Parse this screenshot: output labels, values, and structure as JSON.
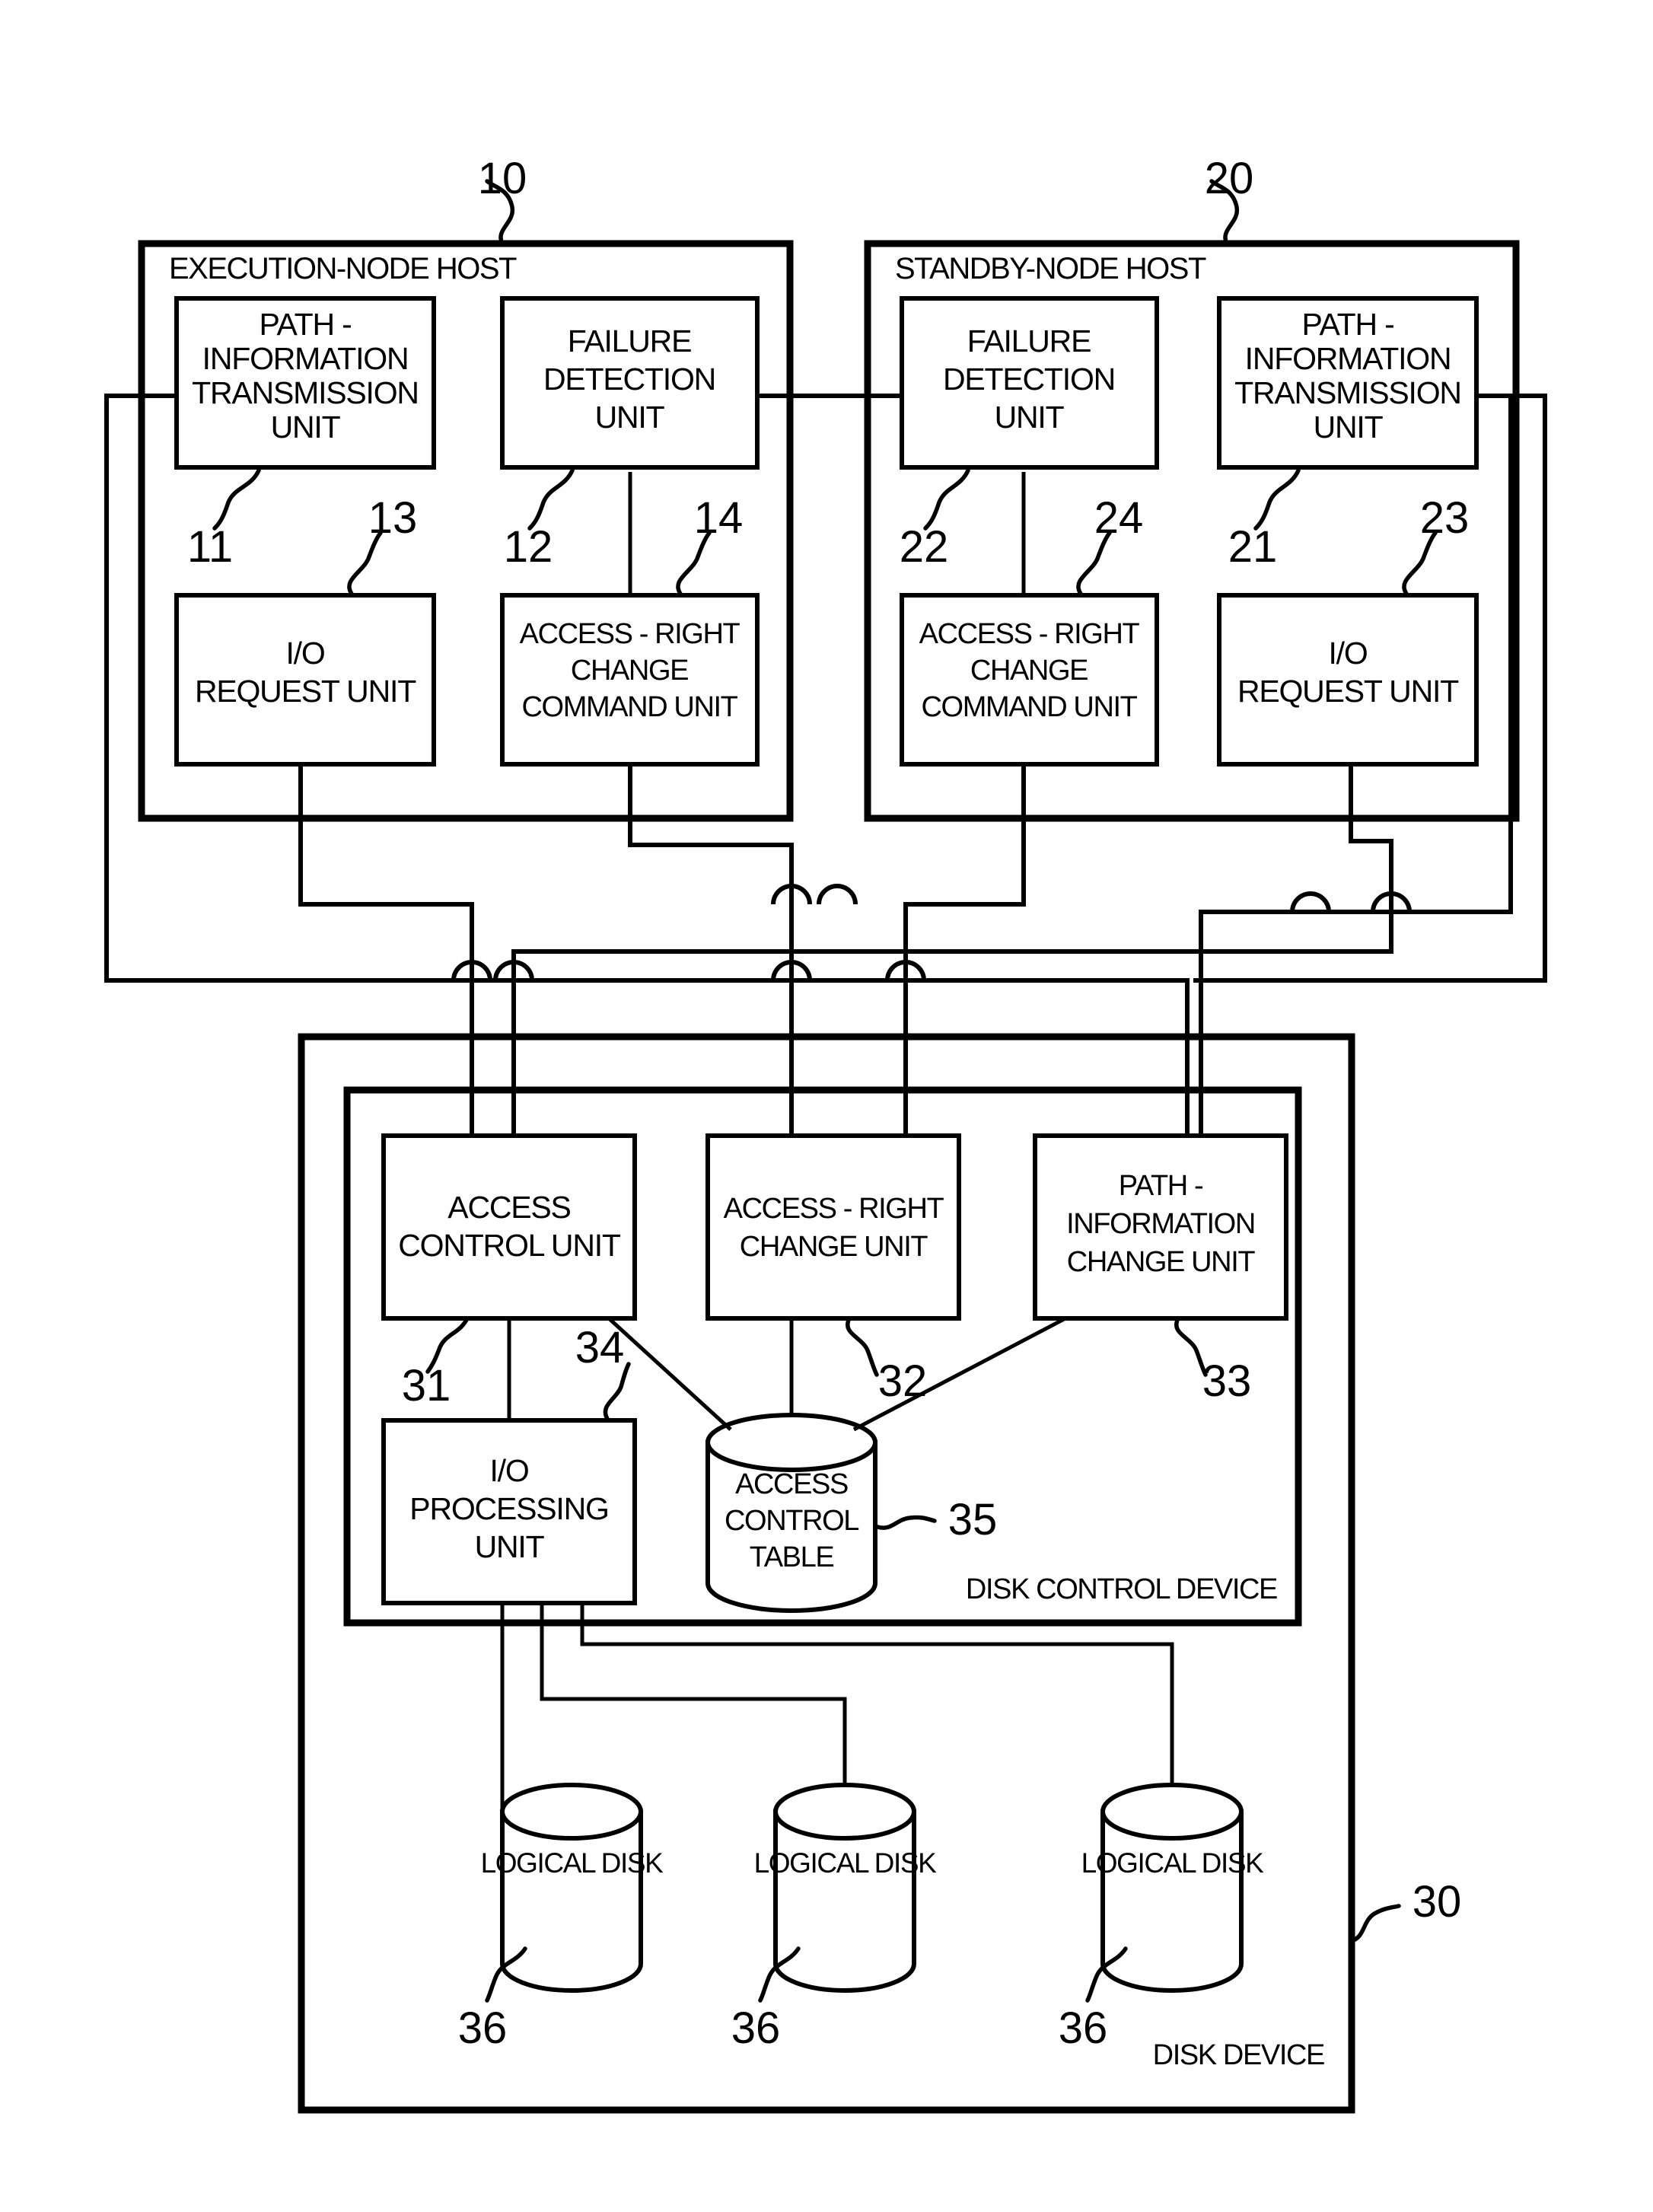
{
  "figure": {
    "title": "Patent figure: execution-node host / standby-node host / disk device block diagram",
    "line_color": "#000000",
    "background_color": "#ffffff"
  },
  "hosts": {
    "execution": {
      "label": "EXECUTION-NODE HOST",
      "ref": "10",
      "units": [
        {
          "id": "path-info-tx-10",
          "ref": "11",
          "lines": [
            "PATH -",
            "INFORMATION",
            "TRANSMISSION",
            "UNIT"
          ]
        },
        {
          "id": "failure-detect-10",
          "ref": "12",
          "lines": [
            "FAILURE",
            "DETECTION",
            "UNIT"
          ]
        },
        {
          "id": "io-request-10",
          "ref": "13",
          "lines": [
            "I/O",
            "REQUEST UNIT"
          ]
        },
        {
          "id": "access-right-cmd-10",
          "ref": "14",
          "lines": [
            "ACCESS - RIGHT",
            "CHANGE",
            "COMMAND UNIT"
          ]
        }
      ]
    },
    "standby": {
      "label": "STANDBY-NODE HOST",
      "ref": "20",
      "units": [
        {
          "id": "failure-detect-20",
          "ref": "22",
          "lines": [
            "FAILURE",
            "DETECTION",
            "UNIT"
          ]
        },
        {
          "id": "path-info-tx-20",
          "ref": "21",
          "lines": [
            "PATH -",
            "INFORMATION",
            "TRANSMISSION",
            "UNIT"
          ]
        },
        {
          "id": "access-right-cmd-20",
          "ref": "24",
          "lines": [
            "ACCESS - RIGHT",
            "CHANGE",
            "COMMAND UNIT"
          ]
        },
        {
          "id": "io-request-20",
          "ref": "23",
          "lines": [
            "I/O",
            "REQUEST UNIT"
          ]
        }
      ]
    }
  },
  "disk_device": {
    "label": "DISK DEVICE",
    "ref": "30",
    "control_device": {
      "label": "DISK CONTROL DEVICE",
      "units": [
        {
          "id": "access-control-unit",
          "ref": "31",
          "lines": [
            "ACCESS",
            "CONTROL UNIT"
          ]
        },
        {
          "id": "access-right-change-unit",
          "ref": "32",
          "lines": [
            "ACCESS - RIGHT",
            "CHANGE UNIT"
          ]
        },
        {
          "id": "path-info-change-unit",
          "ref": "33",
          "lines": [
            "PATH -",
            "INFORMATION",
            "CHANGE UNIT"
          ]
        },
        {
          "id": "io-processing-unit",
          "ref": "34",
          "lines": [
            "I/O",
            "PROCESSING",
            "UNIT"
          ]
        }
      ],
      "table": {
        "id": "access-control-table",
        "ref": "35",
        "lines": [
          "ACCESS",
          "CONTROL",
          "TABLE"
        ]
      }
    },
    "logical_disks": [
      {
        "id": "logical-disk-1",
        "ref": "36",
        "label": "LOGICAL DISK"
      },
      {
        "id": "logical-disk-2",
        "ref": "36",
        "label": "LOGICAL DISK"
      },
      {
        "id": "logical-disk-3",
        "ref": "36",
        "label": "LOGICAL DISK"
      }
    ]
  },
  "ref_labels": {
    "r10": "10",
    "r20": "20",
    "r11": "11",
    "r12": "12",
    "r13": "13",
    "r14": "14",
    "r21": "21",
    "r22": "22",
    "r23": "23",
    "r24": "24",
    "r30": "30",
    "r31": "31",
    "r32": "32",
    "r33": "33",
    "r34": "34",
    "r35": "35",
    "r36a": "36",
    "r36b": "36",
    "r36c": "36"
  }
}
